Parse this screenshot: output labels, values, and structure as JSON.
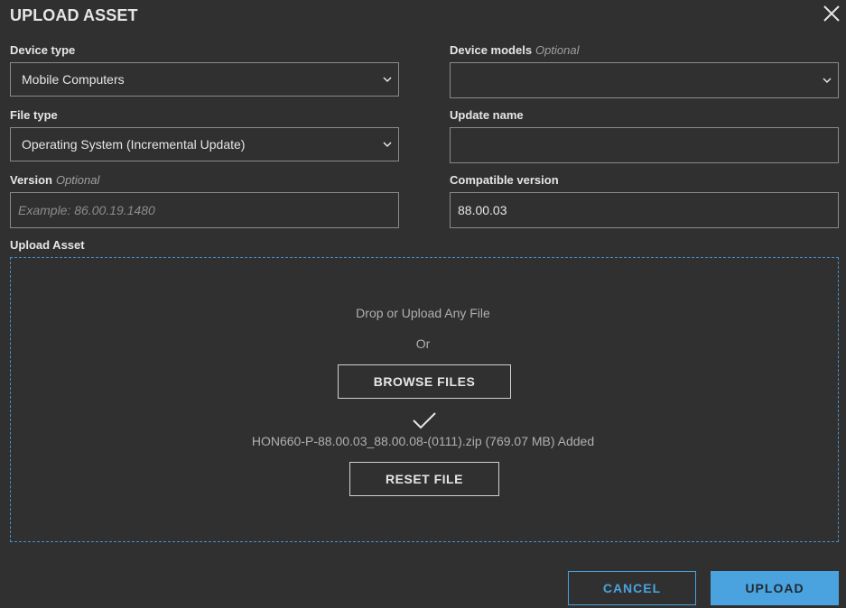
{
  "dialog": {
    "title": "UPLOAD ASSET",
    "close_icon": "close-icon"
  },
  "device_type": {
    "label": "Device type",
    "value": "Mobile Computers"
  },
  "device_models": {
    "label": "Device models",
    "optional_tag": "Optional",
    "value": ""
  },
  "file_type": {
    "label": "File type",
    "value": "Operating System (Incremental Update)"
  },
  "update_name": {
    "label": "Update name",
    "value": ""
  },
  "version": {
    "label": "Version",
    "optional_tag": "Optional",
    "placeholder": "Example: 86.00.19.1480",
    "value": ""
  },
  "compatible_version": {
    "label": "Compatible version",
    "value": "88.00.03"
  },
  "upload_asset": {
    "label": "Upload Asset",
    "drop_text": "Drop or Upload Any File",
    "or_text": "Or",
    "browse_label": "BROWSE FILES",
    "added_file_text": "HON660-P-88.00.03_88.00.08-(0111).zip (769.07 MB) Added",
    "reset_label": "RESET FILE",
    "success_icon": "check-icon"
  },
  "footer": {
    "cancel_label": "CANCEL",
    "upload_label": "UPLOAD"
  },
  "colors": {
    "background": "#303030",
    "accent": "#4aa3df",
    "border": "#8a8a8a",
    "dropzone_border": "#4a90c8"
  }
}
